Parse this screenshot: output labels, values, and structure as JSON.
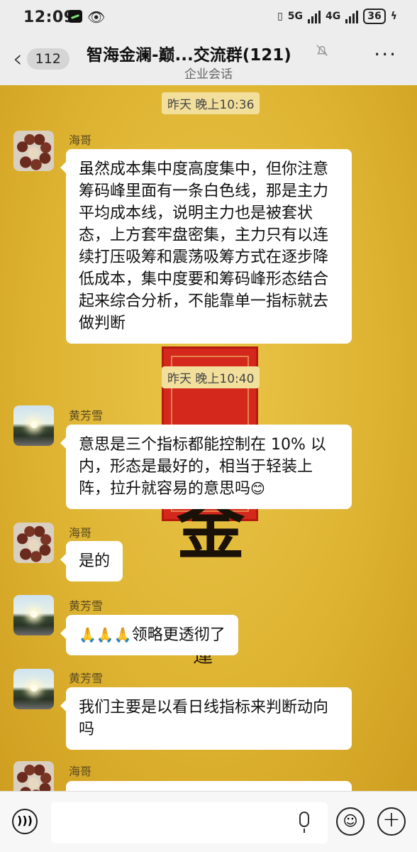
{
  "status_bar": {
    "time": "12:09",
    "battery": "36",
    "network": "5G",
    "network2": "4G"
  },
  "header": {
    "back_count": "112",
    "title": "智海金澜-巅...交流群(121)",
    "subtitle": "企业会话",
    "more": "···"
  },
  "chat": {
    "time_1": "昨天 晚上10:36",
    "time_2": "昨天 晚上10:40",
    "messages": [
      {
        "sender": "海哥",
        "avatar": "beads",
        "text": "虽然成本集中度高度集中，但你注意筹码峰里面有一条白色线，那是主力平均成本线，说明主力也是被套状态，上方套牢盘密集，主力只有以连续打压吸筹和震荡吸筹方式在逐步降低成本，集中度要和筹码峰形态结合起来综合分析，不能靠单一指标就去做判断"
      },
      {
        "sender": "黄芳雪",
        "avatar": "road",
        "text": "意思是三个指标都能控制在 10% 以内，形态是最好的，相当于轻装上阵，拉升就容易的意思吗",
        "emoji": "😊"
      },
      {
        "sender": "海哥",
        "avatar": "beads",
        "text": "是的"
      },
      {
        "sender": "黄芳雪",
        "avatar": "road",
        "emoji_prefix": "🙏🙏🙏",
        "text": "领略更透彻了"
      },
      {
        "sender": "黄芳雪",
        "avatar": "road",
        "text": "我们主要是以看日线指标来判断动向吗"
      },
      {
        "sender": "海哥",
        "avatar": "beads",
        "text": ""
      }
    ]
  },
  "input_bar": {
    "placeholder": ""
  },
  "colors": {
    "chat_bg": "#ddb230",
    "bubble": "#ffffff",
    "seal_red": "#d4281c"
  }
}
